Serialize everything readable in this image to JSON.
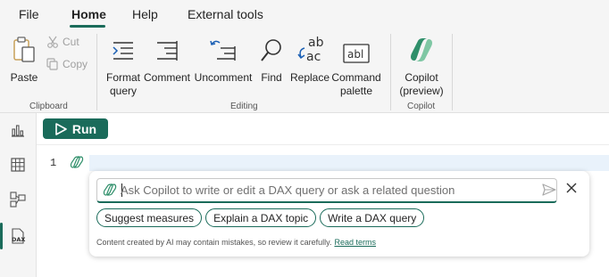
{
  "menubar": {
    "tabs": [
      {
        "label": "File"
      },
      {
        "label": "Home",
        "active": true
      },
      {
        "label": "Help"
      },
      {
        "label": "External tools"
      }
    ]
  },
  "ribbon": {
    "clipboard": {
      "paste": "Paste",
      "cut": "Cut",
      "copy": "Copy",
      "group_label": "Clipboard"
    },
    "editing": {
      "format_query_line1": "Format",
      "format_query_line2": "query",
      "comment": "Comment",
      "uncomment": "Uncomment",
      "find": "Find",
      "replace": "Replace",
      "command_palette_line1": "Command",
      "command_palette_line2": "palette",
      "group_label": "Editing"
    },
    "copilot": {
      "button_line1": "Copilot",
      "button_line2": "(preview)",
      "group_label": "Copilot"
    }
  },
  "left_rail": {
    "icons": [
      "report-view-icon",
      "table-view-icon",
      "model-view-icon",
      "dax-query-view-icon"
    ],
    "active": "dax-query-view-icon",
    "dax_label": "DAX"
  },
  "toolbar": {
    "run_label": "Run"
  },
  "editor": {
    "line_numbers": [
      "1"
    ]
  },
  "copilot_popup": {
    "placeholder": "Ask Copilot to write or edit a DAX query or ask a related question",
    "suggestions": [
      "Suggest measures",
      "Explain a DAX topic",
      "Write a DAX query"
    ],
    "disclaimer": "Content created by AI may contain mistakes, so review it carefully.",
    "read_terms": "Read terms"
  },
  "colors": {
    "accent": "#1a6b5a",
    "ribbon_bg": "#f5f5f5",
    "line_highlight": "#e9f2fb"
  }
}
